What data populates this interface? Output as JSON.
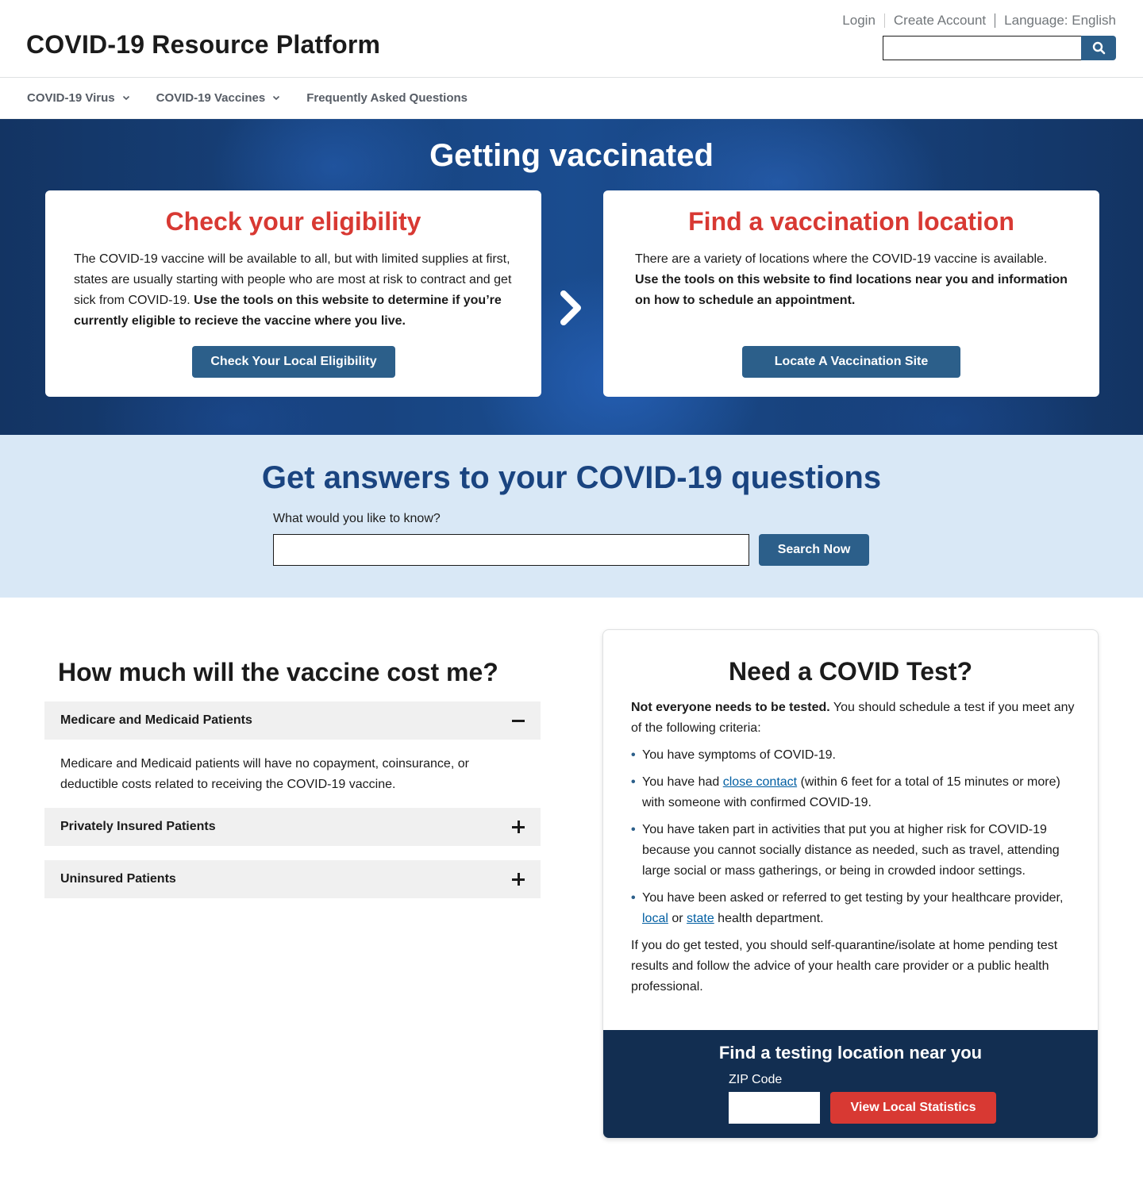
{
  "header": {
    "site_title": "COVID-19 Resource Platform",
    "utility_links": {
      "login": "Login",
      "create_account": "Create Account",
      "language": "Language: English"
    },
    "search": {
      "value": "",
      "icon": "search-icon"
    }
  },
  "nav": {
    "items": [
      {
        "label": "COVID-19 Virus",
        "has_dropdown": true
      },
      {
        "label": "COVID-19 Vaccines",
        "has_dropdown": true
      },
      {
        "label": "Frequently Asked Questions",
        "has_dropdown": false
      }
    ]
  },
  "hero": {
    "title": "Getting vaccinated",
    "arrow_icon": "chevron-right-icon",
    "cards": [
      {
        "heading": "Check your eligibility",
        "text": "The COVID-19 vaccine will be available to all, but with limited supplies at first, states are usually starting with people who are most at risk to contract and get sick from COVID-19. ",
        "bold_text": "Use the tools on this website to determine if you’re currently eligible to recieve the vaccine where you live.",
        "button": "Check Your Local Eligibility"
      },
      {
        "heading": "Find a vaccination location",
        "text": "There are a variety of locations where the COVID-19 vaccine is available. ",
        "bold_text": "Use the tools on this website to find locations near you and information on how to schedule an appointment.",
        "button": "Locate A Vaccination Site"
      }
    ]
  },
  "questions": {
    "title": "Get answers to your COVID-19 questions",
    "label": "What would you like to know?",
    "input_value": "",
    "button": "Search Now"
  },
  "cost": {
    "title": "How much will the vaccine cost me?",
    "accordion": [
      {
        "label": "Medicare and Medicaid Patients",
        "expanded": true,
        "icon": "minus-icon",
        "body": "Medicare and Medicaid patients will have no copayment, coinsurance, or deductible costs related to receiving the COVID-19 vaccine."
      },
      {
        "label": "Privately Insured Patients",
        "expanded": false,
        "icon": "plus-icon"
      },
      {
        "label": "Uninsured Patients",
        "expanded": false,
        "icon": "plus-icon"
      }
    ]
  },
  "test": {
    "title": "Need a COVID Test?",
    "intro_bold": "Not everyone needs to be tested.",
    "intro_text": " You should schedule a test if you meet any of the following criteria:",
    "criteria": {
      "c1": "You have symptoms of COVID-19.",
      "c2_before": "You have had ",
      "c2_link": "close contact",
      "c2_after": " (within 6 feet for a total of 15 minutes or more) with someone with confirmed COVID-19.",
      "c3": "You have taken part in activities that put you at higher risk for COVID-19 because you cannot socially distance as needed, such as travel, attending large social or mass gatherings, or being in crowded indoor settings.",
      "c4_before": "You have been asked or referred to get testing by your healthcare provider, ",
      "c4_link1": "local",
      "c4_mid": " or ",
      "c4_link2": "state",
      "c4_after": " health department."
    },
    "after_text": "If you do get tested, you should self-quarantine/isolate at home pending test results and follow the advice of your health care provider or a public health professional.",
    "footer": {
      "title": "Find a testing location near you",
      "zip_label": "ZIP Code",
      "zip_value": "",
      "button": "View Local Statistics"
    }
  },
  "colors": {
    "primary_blue": "#2c5f8a",
    "heading_red": "#d83933",
    "dark_navy": "#122e51",
    "light_blue_band": "#d9e8f6",
    "questions_title": "#1a4480",
    "link_blue": "#005ea2"
  }
}
